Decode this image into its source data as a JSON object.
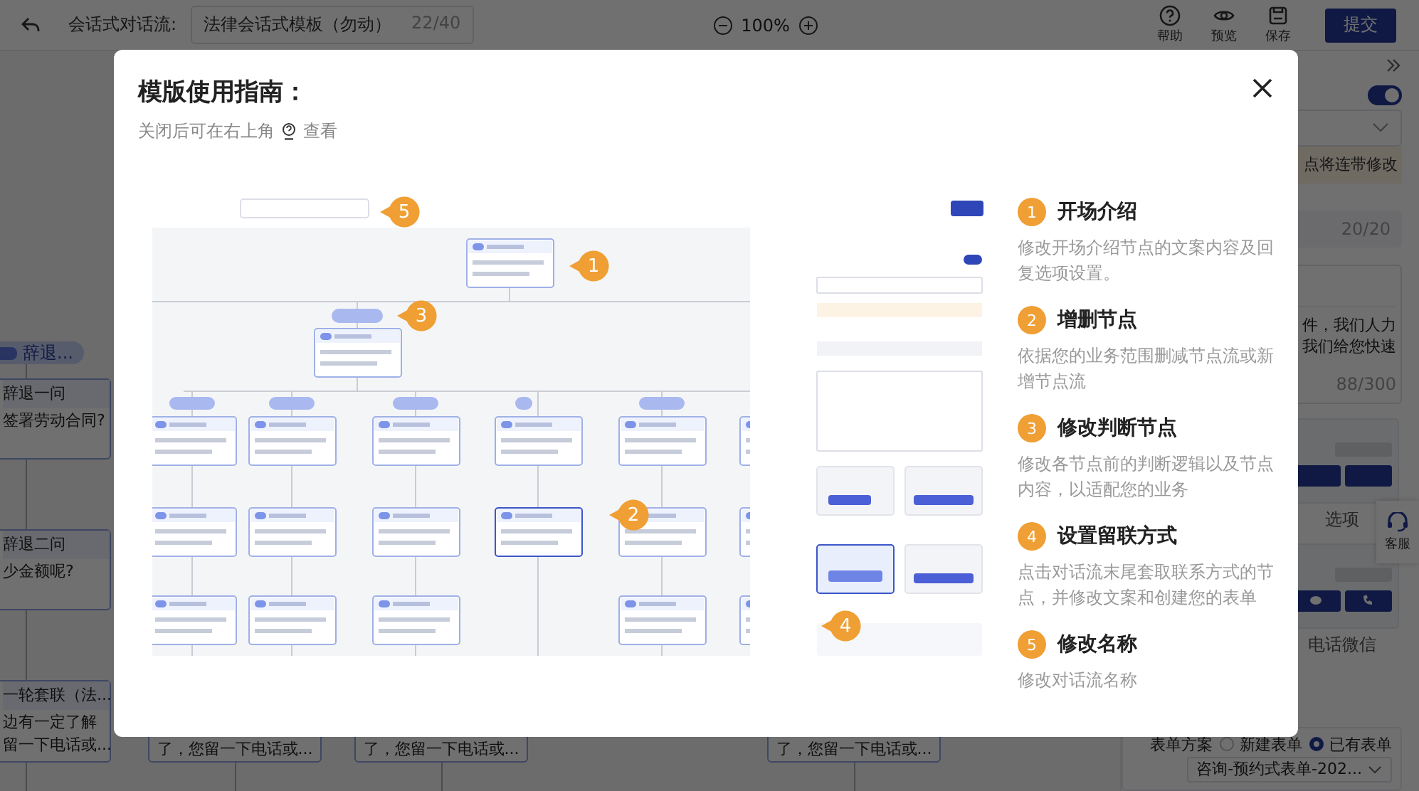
{
  "background_app": {
    "top_bar": {
      "title_label": "会话式对话流:",
      "name_field": "法律会话式模板（勿动）",
      "name_count": "22/40",
      "zoom": "100%",
      "actions": [
        {
          "kind": "help",
          "label": "帮助"
        },
        {
          "kind": "preview",
          "label": "预览"
        },
        {
          "kind": "save",
          "label": "保存"
        }
      ],
      "submit": "提交"
    },
    "canvas": {
      "branch_tag": "辞退...",
      "nodes": [
        {
          "title": "辞退一问",
          "lines": [
            "签署劳动合同?"
          ]
        },
        {
          "title": "辞退二问",
          "lines": [
            "少金额呢?"
          ]
        },
        {
          "title": "一轮套联（法...",
          "lines": [
            "边有一定了解",
            "留一下电话或..."
          ]
        }
      ],
      "bottom_nodes": [
        "了，您留一下电话或...",
        "了，您留一下电话或...",
        "了，您留一下电话或..."
      ]
    },
    "side_panel": {
      "reference_toggle": {
        "on": true
      },
      "alert": "点将连带修改",
      "name_count": "20/20",
      "script_lines": [
        "件，我们人力",
        "我们给您快速"
      ],
      "script_count": "88/300",
      "templates": [
        {
          "kind": "options",
          "label": "选项"
        },
        {
          "kind": "contact",
          "label": "电话微信"
        }
      ],
      "support": "客服",
      "form_scheme": {
        "label": "表单方案",
        "options": [
          {
            "label": "新建表单",
            "selected": false
          },
          {
            "label": "已有表单",
            "selected": true
          }
        ],
        "form_select": "咨询-预约式表单-202..."
      }
    }
  },
  "modal": {
    "title": "模版使用指南：",
    "hint_before": "关闭后可在右上角",
    "hint_after": "查看",
    "guide_picture": {
      "kind": "picture",
      "callouts": [
        "5",
        "1",
        "3",
        "2",
        "4"
      ]
    },
    "steps": [
      {
        "number": "1",
        "title": "开场介绍",
        "description": "修改开场介绍节点的文案内容及回复选项设置。"
      },
      {
        "number": "2",
        "title": "增删节点",
        "description": "依据您的业务范围删减节点流或新增节点流"
      },
      {
        "number": "3",
        "title": "修改判断节点",
        "description": "修改各节点前的判断逻辑以及节点内容，以适配您的业务"
      },
      {
        "number": "4",
        "title": "设置留联方式",
        "description": "点击对话流末尾套取联系方式的节点，并修改文案和创建您的表单"
      },
      {
        "number": "5",
        "title": "修改名称",
        "description": "修改对话流名称"
      }
    ]
  }
}
